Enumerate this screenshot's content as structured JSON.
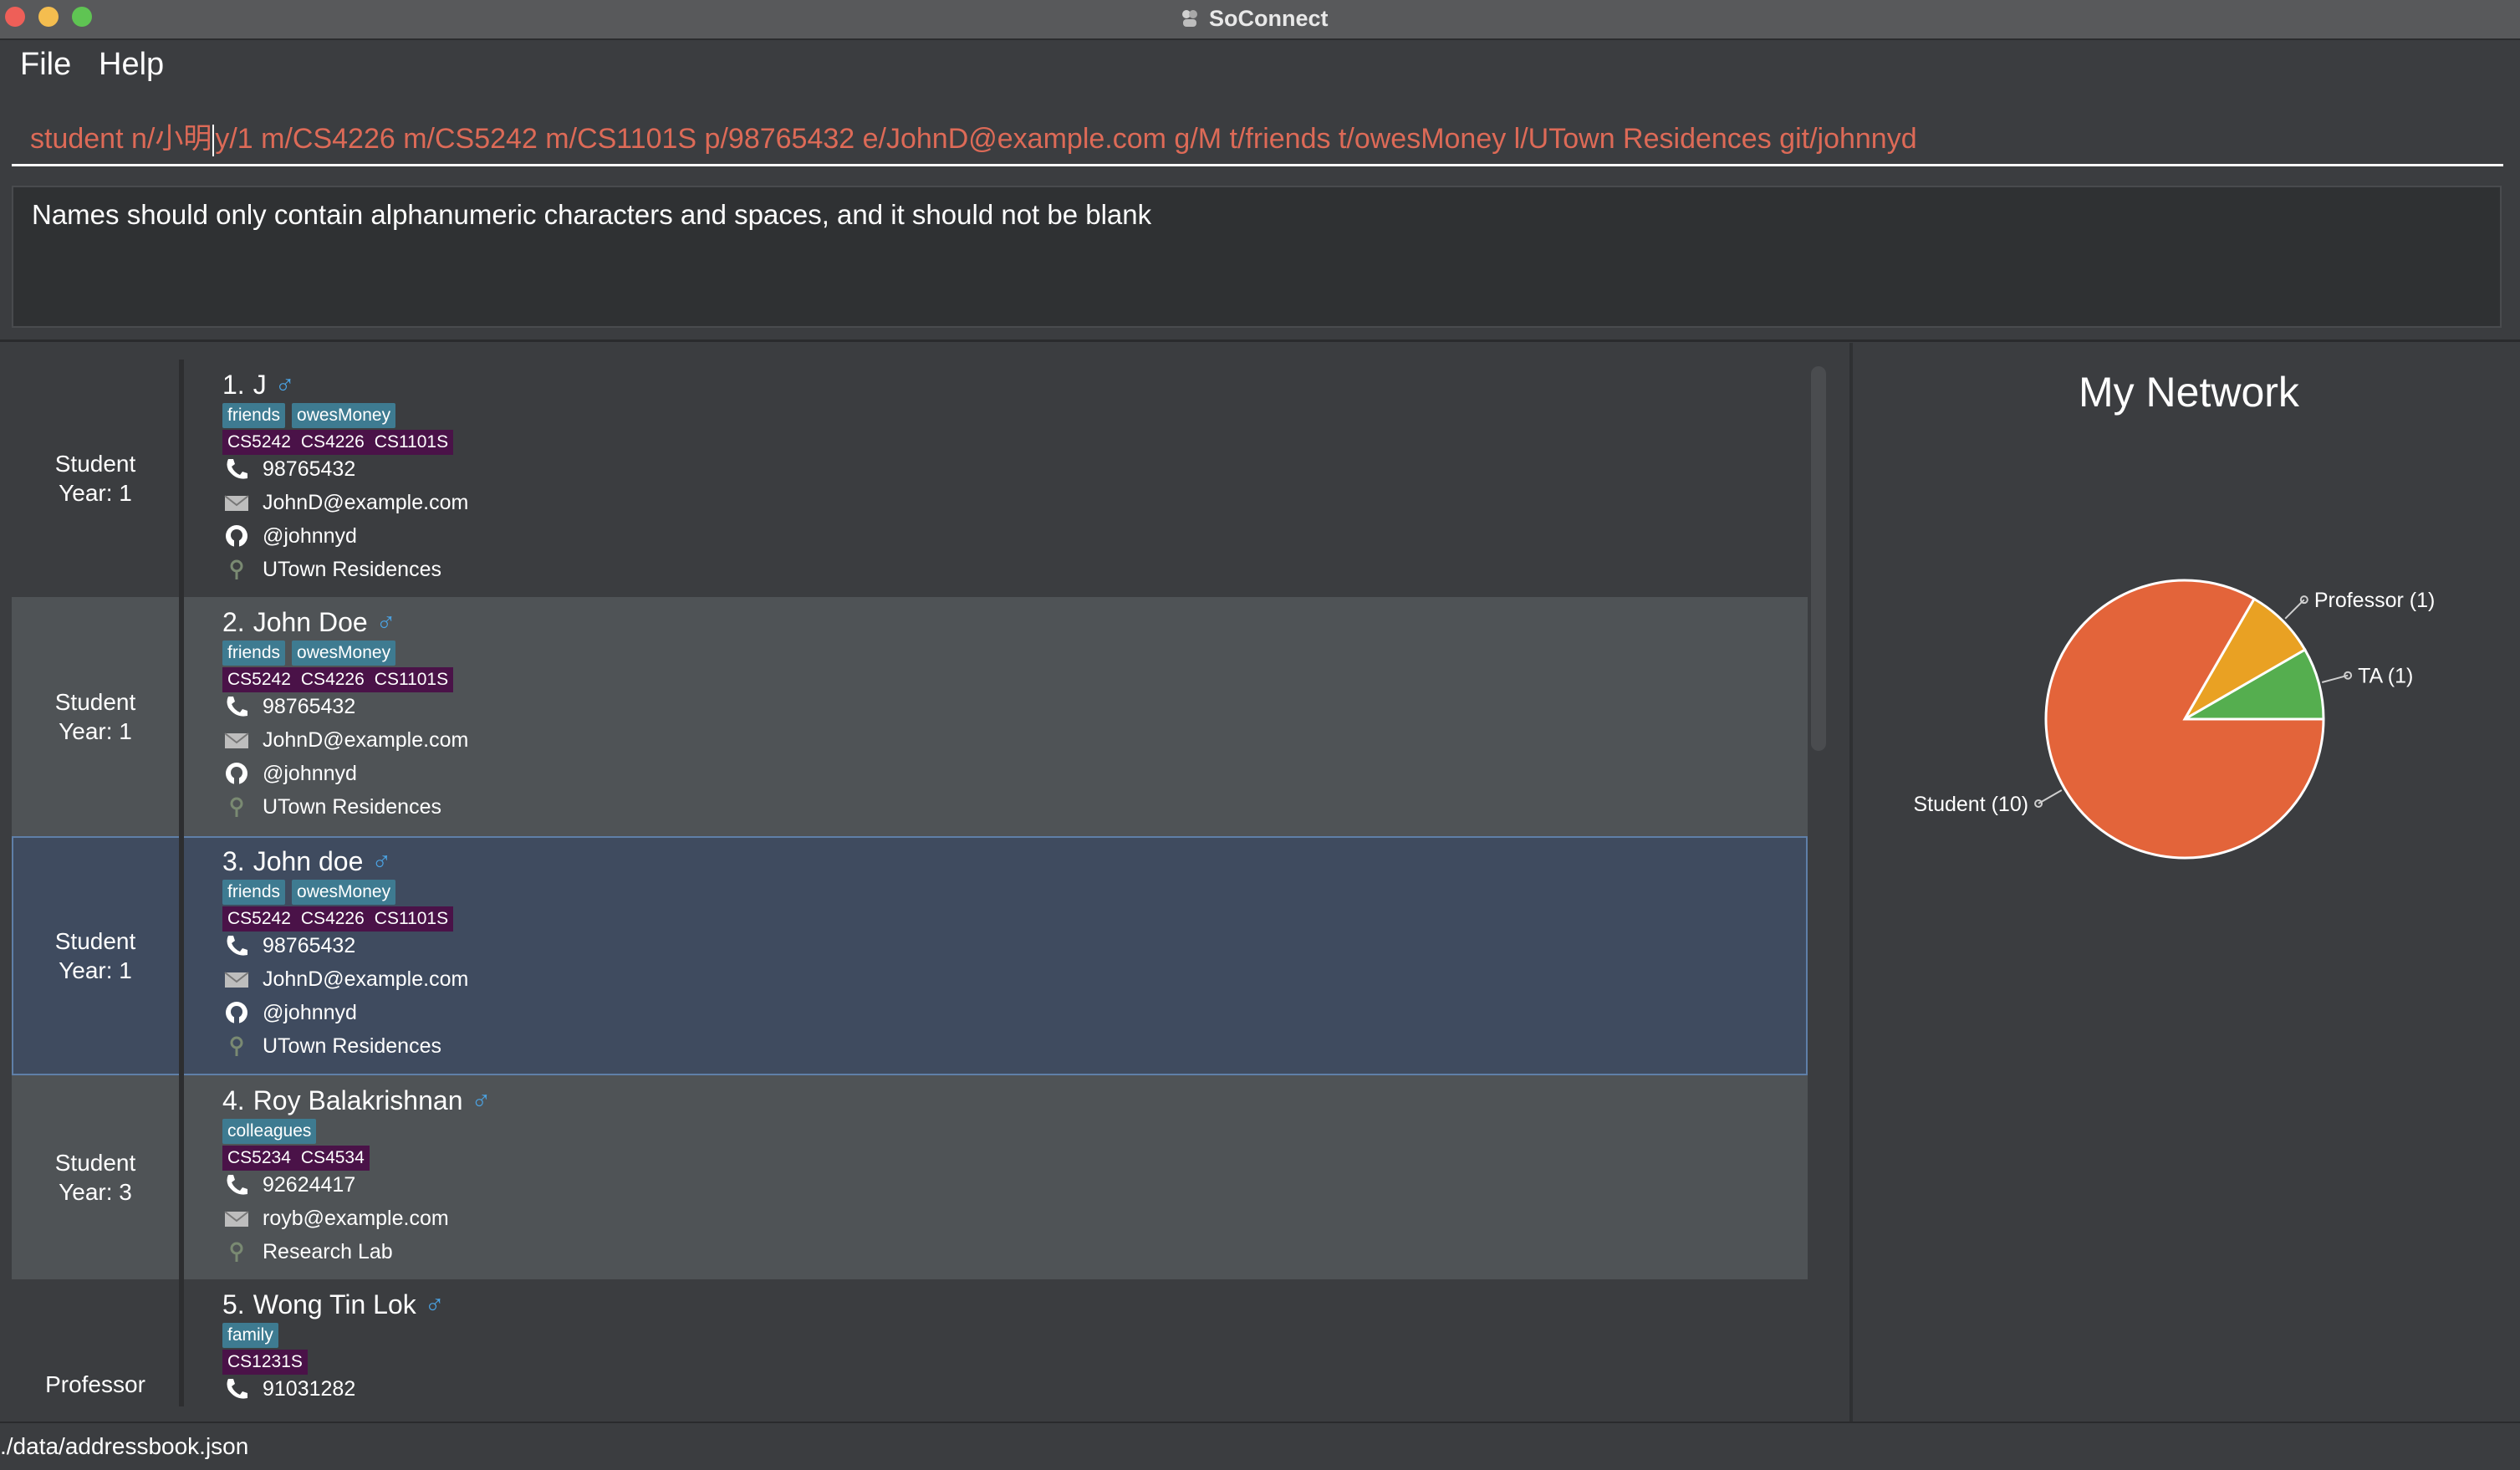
{
  "window": {
    "title": "SoConnect"
  },
  "menu": {
    "file": "File",
    "help": "Help"
  },
  "command": {
    "value_before_caret": "student n/小明",
    "value_after_caret": "y/1 m/CS4226 m/CS5242 m/CS1101S p/98765432 e/JohnD@example.com g/M t/friends t/owesMoney l/UTown Residences git/johnnyd"
  },
  "result": {
    "message": "Names should only contain alphanumeric characters and spaces, and it should not be blank"
  },
  "persons": [
    {
      "index": "1.",
      "name": "J",
      "gender": "♂",
      "role": "Student",
      "year": "Year: 1",
      "tags": [
        "friends",
        "owesMoney"
      ],
      "modules": [
        "CS5242",
        "CS4226",
        "CS1101S"
      ],
      "phone": "98765432",
      "email": "JohnD@example.com",
      "github": "@johnnyd",
      "location": "UTown Residences"
    },
    {
      "index": "2.",
      "name": "John Doe",
      "gender": "♂",
      "role": "Student",
      "year": "Year: 1",
      "tags": [
        "friends",
        "owesMoney"
      ],
      "modules": [
        "CS5242",
        "CS4226",
        "CS1101S"
      ],
      "phone": "98765432",
      "email": "JohnD@example.com",
      "github": "@johnnyd",
      "location": "UTown Residences"
    },
    {
      "index": "3.",
      "name": "John doe",
      "gender": "♂",
      "role": "Student",
      "year": "Year: 1",
      "tags": [
        "friends",
        "owesMoney"
      ],
      "modules": [
        "CS5242",
        "CS4226",
        "CS1101S"
      ],
      "phone": "98765432",
      "email": "JohnD@example.com",
      "github": "@johnnyd",
      "location": "UTown Residences"
    },
    {
      "index": "4.",
      "name": "Roy Balakrishnan",
      "gender": "♂",
      "role": "Student",
      "year": "Year: 3",
      "tags": [
        "colleagues"
      ],
      "modules": [
        "CS5234",
        "CS4534"
      ],
      "phone": "92624417",
      "email": "royb@example.com",
      "location": "Research Lab"
    },
    {
      "index": "5.",
      "name": "Wong Tin Lok",
      "gender": "♂",
      "role": "Professor",
      "tags": [
        "family"
      ],
      "modules": [
        "CS1231S"
      ],
      "phone": "91031282"
    }
  ],
  "network": {
    "title": "My Network",
    "chart_data": {
      "type": "pie",
      "categories": [
        "Student (10)",
        "Professor (1)",
        "TA (1)"
      ],
      "values": [
        10,
        1,
        1
      ],
      "colors": [
        "#e3643a",
        "#e9a123",
        "#55ae4f"
      ]
    }
  },
  "status": {
    "path": "./data/addressbook.json"
  },
  "icons": {
    "phone": "phone-icon",
    "email": "envelope-icon",
    "github": "github-icon",
    "location": "location-pin-icon"
  }
}
